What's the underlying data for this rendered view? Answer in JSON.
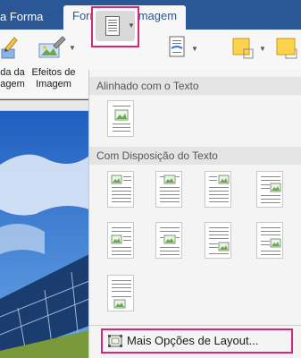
{
  "tabs": {
    "forma": "a Forma",
    "active": "Formato da Imagem"
  },
  "ribbon": {
    "item1_label_line1": "da da",
    "item1_label_line2": "agem",
    "item2_label_line1": "Efeitos de",
    "item2_label_line2": "Imagem"
  },
  "menu": {
    "section_inline": "Alinhado com o Texto",
    "section_wrap": "Com Disposição do Texto",
    "more_layout": "Mais Opções de Layout..."
  },
  "colors": {
    "accent_tab": "#2b5797",
    "highlight": "#d6267a",
    "shape_fill": "#fcd34d"
  }
}
